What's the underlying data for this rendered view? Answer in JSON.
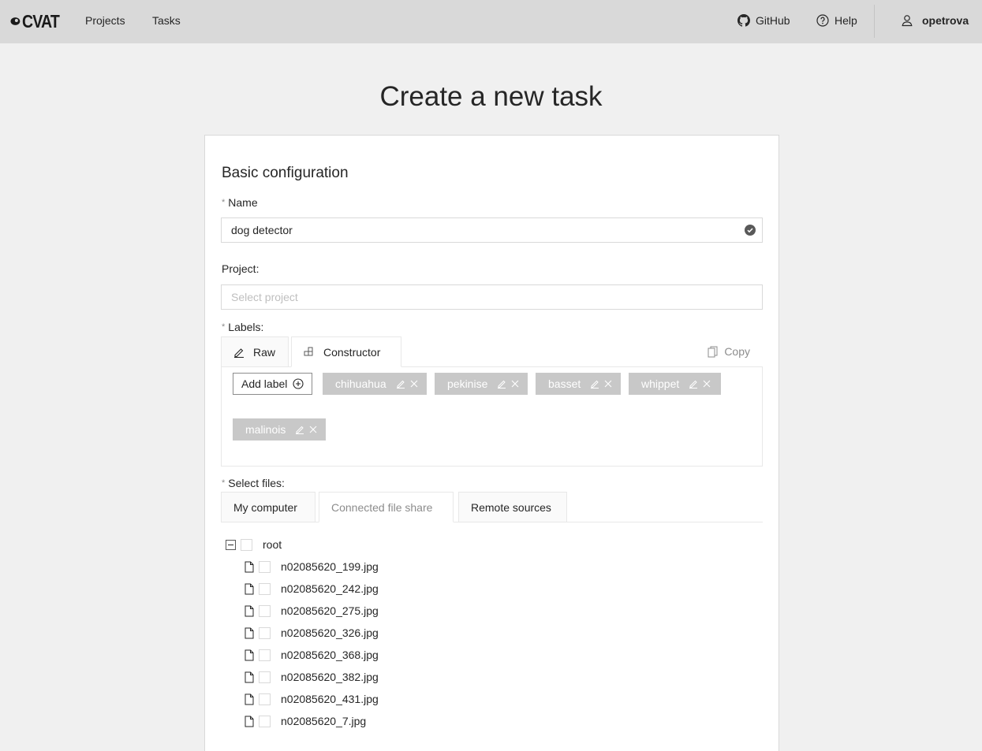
{
  "header": {
    "logo_text": "CVAT",
    "nav": [
      "Projects",
      "Tasks"
    ],
    "github": "GitHub",
    "help": "Help",
    "user": "opetrova"
  },
  "page_title": "Create a new task",
  "form": {
    "section_title": "Basic configuration",
    "name_label": "Name",
    "name_value": "dog detector",
    "project_label": "Project:",
    "project_placeholder": "Select project",
    "labels_label": "Labels:",
    "label_tabs": [
      "Raw",
      "Constructor"
    ],
    "copy_label": "Copy",
    "add_label": "Add label",
    "labels": [
      "chihuahua",
      "pekinise",
      "basset",
      "whippet",
      "malinois"
    ],
    "files_label": "Select files:",
    "file_tabs": [
      "My computer",
      "Connected file share",
      "Remote sources"
    ],
    "tree": {
      "root": "root",
      "files": [
        "n02085620_199.jpg",
        "n02085620_242.jpg",
        "n02085620_275.jpg",
        "n02085620_326.jpg",
        "n02085620_368.jpg",
        "n02085620_382.jpg",
        "n02085620_431.jpg",
        "n02085620_7.jpg"
      ]
    }
  },
  "colors": {
    "header_bg": "#d9d9d9",
    "page_bg": "#f0f0f0",
    "label_chip_bg": "#c8c8c8"
  },
  "icons": {
    "github": "github-icon",
    "help": "question-circle-icon",
    "user": "user-icon",
    "raw_tab": "edit-icon",
    "constructor_tab": "build-icon",
    "copy": "copy-icon",
    "add_label": "plus-circle-icon",
    "chip_edit": "edit-icon",
    "chip_delete": "close-icon",
    "file": "file-icon",
    "tree_collapse": "minus-square-icon",
    "name_valid": "check-circle-icon"
  }
}
